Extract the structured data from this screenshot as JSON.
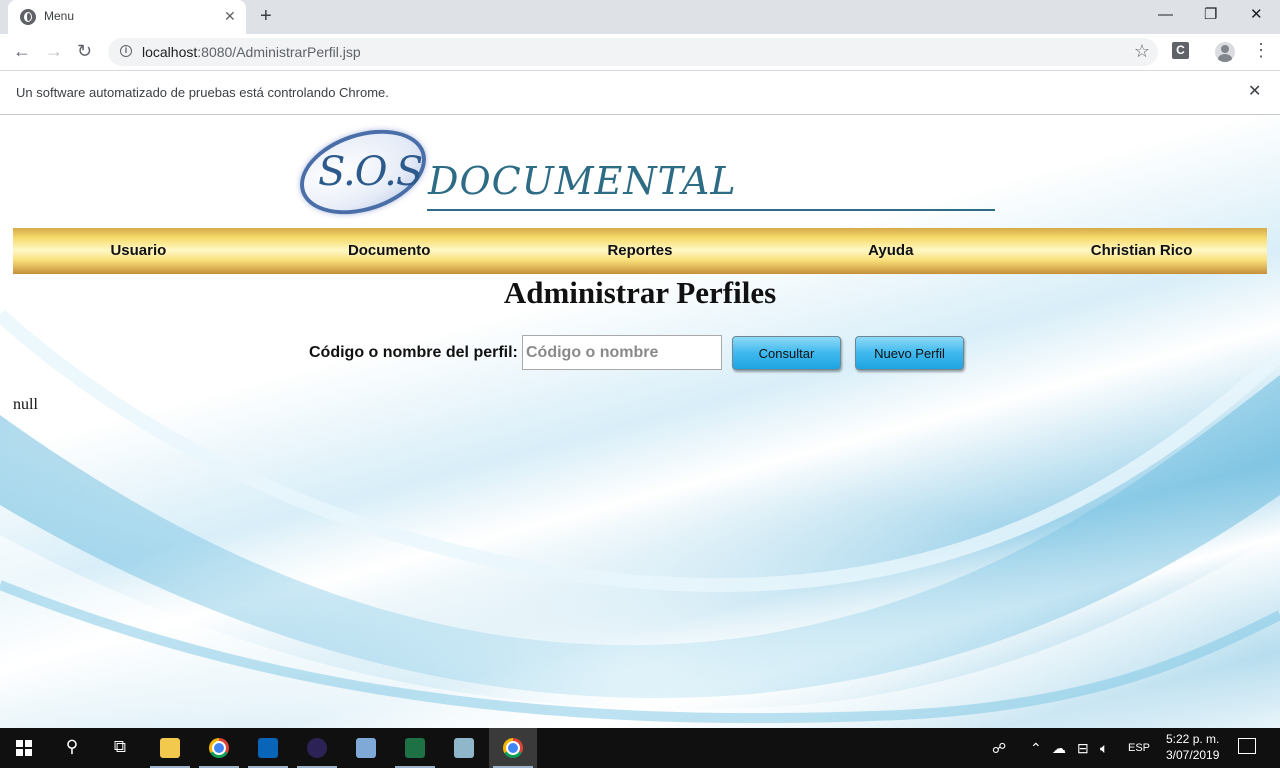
{
  "browser": {
    "tab_title": "Menu",
    "url_host": "localhost",
    "url_rest": ":8080/AdministrarPerfil.jsp",
    "ext_letter": "C",
    "infobar_text": "Un software automatizado de pruebas está controlando Chrome."
  },
  "logo": {
    "sos": "S.O.S",
    "name": "DOCUMENTAL"
  },
  "menu": {
    "items": [
      {
        "label": "Usuario"
      },
      {
        "label": "Documento"
      },
      {
        "label": "Reportes"
      },
      {
        "label": "Ayuda"
      },
      {
        "label": "Christian Rico"
      }
    ]
  },
  "page": {
    "title": "Administrar Perfiles",
    "search_label": "Código o nombre del perfil:",
    "search_placeholder": "Código o nombre",
    "search_value": "",
    "consultar_label": "Consultar",
    "nuevo_label": "Nuevo Perfil",
    "result_text": "null"
  },
  "taskbar": {
    "language": "ESP",
    "time": "5:22 p. m.",
    "date": "3/07/2019",
    "apps": [
      "file-explorer",
      "chrome",
      "outlook",
      "eclipse",
      "virtualbox",
      "excel",
      "notepad",
      "chrome-active"
    ]
  },
  "colors": {
    "menu_gold": "#f7dc6c",
    "button_blue": "#3fb8ee",
    "logo_teal": "#2e6b85"
  }
}
